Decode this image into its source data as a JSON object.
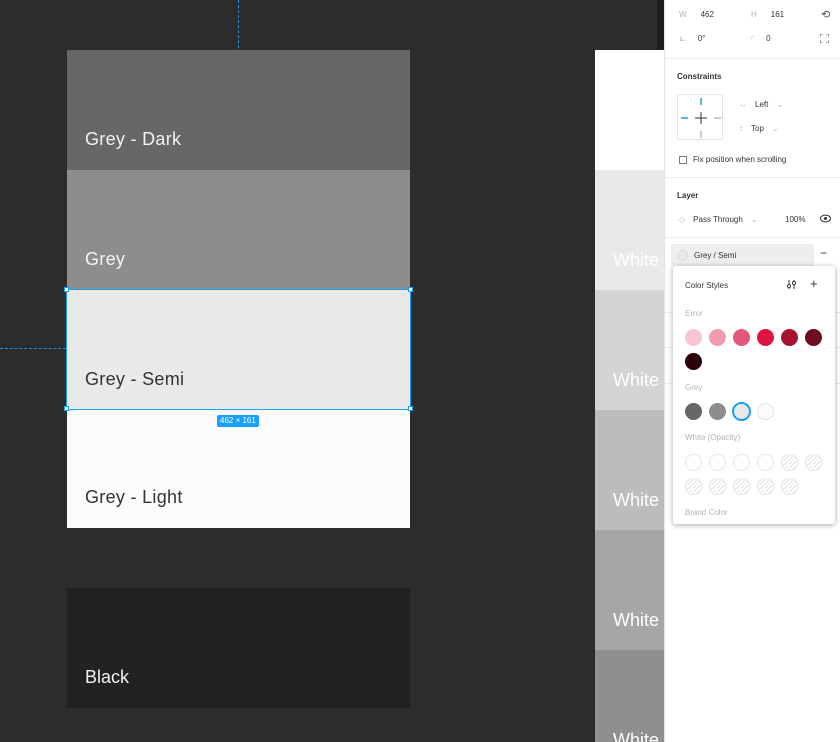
{
  "canvas": {
    "swatches": [
      {
        "label": "Grey - Dark",
        "bg": "#676767",
        "fg": "#f2f2f2"
      },
      {
        "label": "Grey",
        "bg": "#8d8d8d",
        "fg": "#f5f5f5"
      },
      {
        "label": "Grey - Semi",
        "bg": "#e9e9e9",
        "fg": "#333333"
      },
      {
        "label": "Grey - Light",
        "bg": "#fbfbfb",
        "fg": "#333333"
      }
    ],
    "black_label": "Black",
    "size_badge": "462 × 161",
    "white_label": "White",
    "white_column_bgs": [
      "#ffffff",
      "#e9e9e9",
      "#d4d4d4",
      "#bcbcbc",
      "#a6a6a6",
      "#8f8f8f"
    ]
  },
  "panel": {
    "w_label": "W",
    "w_value": "462",
    "h_label": "H",
    "h_value": "161",
    "rotation_value": "0°",
    "radius_value": "0",
    "constraints_title": "Constraints",
    "horizontal_constraint": "Left",
    "vertical_constraint": "Top",
    "fix_position_label": "Fix position when scrolling",
    "layer_title": "Layer",
    "blend_mode": "Pass Through",
    "opacity": "100%",
    "fill_style_name": "Grey / Semi"
  },
  "color_styles": {
    "title": "Color Styles",
    "groups": [
      {
        "label": "Error",
        "colors": [
          "#f8c5d2",
          "#f29bb0",
          "#e5577a",
          "#dd1340",
          "#a4132f",
          "#6d0d1d",
          "#2a0208"
        ]
      },
      {
        "label": "Grey",
        "colors": [
          "#676767",
          "#8d8d8d",
          "#e9e9e9",
          "#fbfbfb"
        ],
        "selected_index": 2
      },
      {
        "label": "White (Opacity)",
        "count": 11
      }
    ],
    "brand_label": "Brand Color"
  },
  "colors": {
    "selection": "#18a0fb",
    "canvas_bg": "#2c2c2c"
  }
}
